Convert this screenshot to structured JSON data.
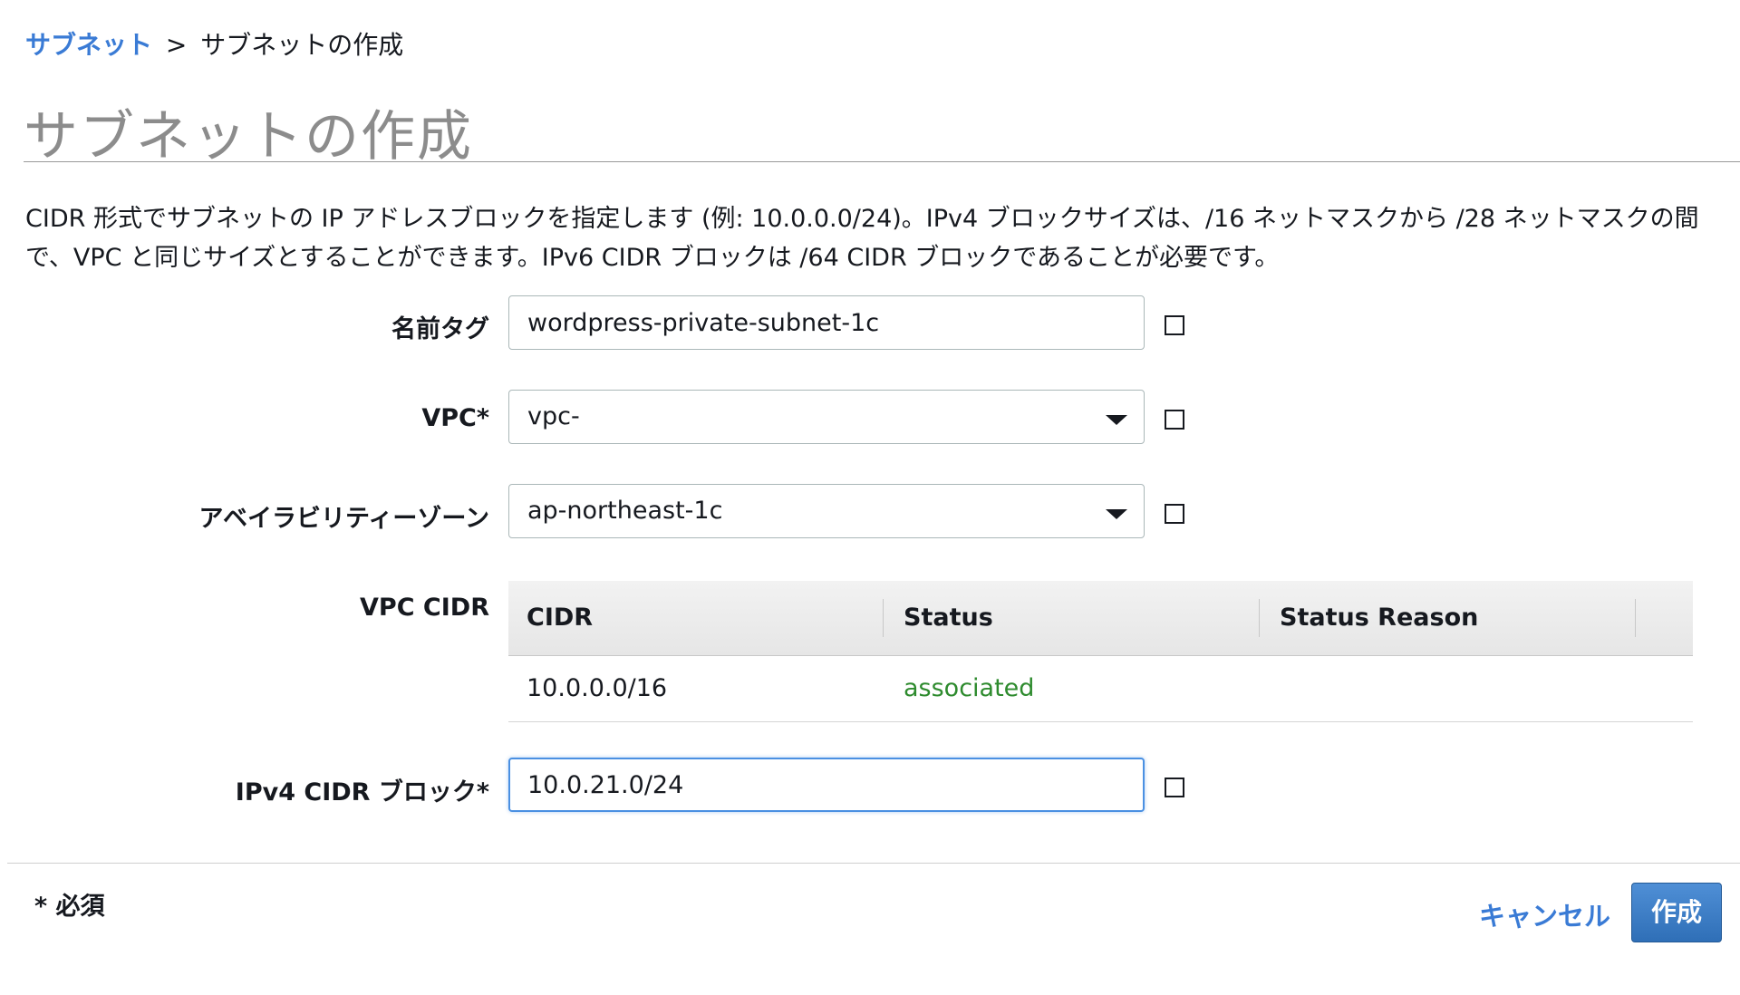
{
  "breadcrumb": {
    "parent": "サブネット",
    "separator": ">",
    "current": "サブネットの作成"
  },
  "page": {
    "title": "サブネットの作成",
    "description": "CIDR 形式でサブネットの IP アドレスブロックを指定します (例: 10.0.0.0/24)。IPv4 ブロックサイズは、/16 ネットマスクから /28 ネットマスクの間で、VPC と同じサイズとすることができます。IPv6 CIDR ブロックは /64 CIDR ブロックであることが必要です。"
  },
  "form": {
    "name_tag": {
      "label": "名前タグ",
      "value": "wordpress-private-subnet-1c"
    },
    "vpc": {
      "label": "VPC*",
      "value": "vpc-"
    },
    "availability_zone": {
      "label": "アベイラビリティーゾーン",
      "value": "ap-northeast-1c"
    },
    "vpc_cidr": {
      "label": "VPC CIDR",
      "columns": [
        "CIDR",
        "Status",
        "Status Reason"
      ],
      "rows": [
        {
          "cidr": "10.0.0.0/16",
          "status": "associated",
          "status_reason": ""
        }
      ]
    },
    "ipv4_cidr": {
      "label": "IPv4 CIDR ブロック*",
      "value": "10.0.21.0/24"
    }
  },
  "footer": {
    "required_note": "* 必須",
    "cancel_label": "キャンセル",
    "create_label": "作成"
  },
  "colors": {
    "link": "#3a7bd5",
    "status_associated": "#2e8b2e",
    "primary_button": "#2f6fb7",
    "focus_border": "#4a90e2"
  }
}
